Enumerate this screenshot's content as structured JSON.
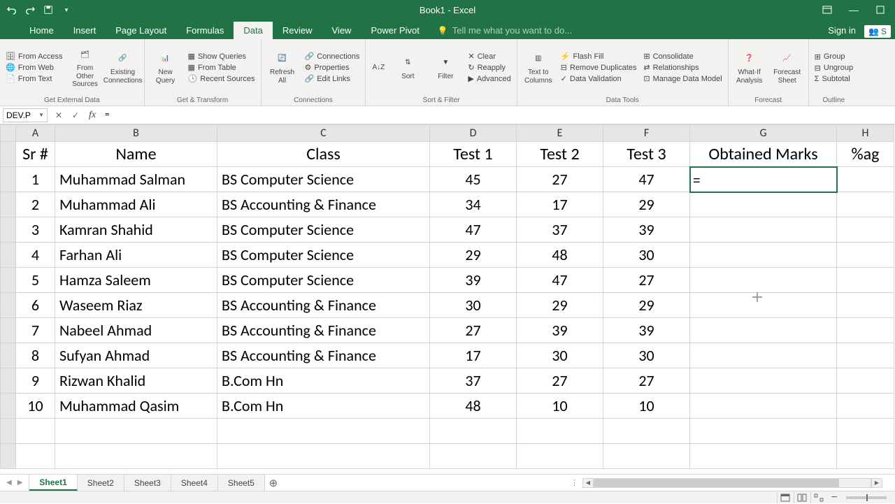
{
  "window": {
    "title": "Book1 - Excel"
  },
  "tabs": {
    "list": [
      "Home",
      "Insert",
      "Page Layout",
      "Formulas",
      "Data",
      "Review",
      "View",
      "Power Pivot"
    ],
    "active": "Data",
    "tellme": "Tell me what you want to do...",
    "signin": "Sign in",
    "share": "S"
  },
  "ribbon": {
    "getExternal": {
      "label": "Get External Data",
      "fromAccess": "From Access",
      "fromWeb": "From Web",
      "fromText": "From Text",
      "fromOther": "From Other Sources",
      "existing": "Existing Connections"
    },
    "getTransform": {
      "label": "Get & Transform",
      "newQuery": "New Query",
      "showQueries": "Show Queries",
      "fromTable": "From Table",
      "recentSources": "Recent Sources"
    },
    "connections": {
      "label": "Connections",
      "refreshAll": "Refresh All",
      "connections": "Connections",
      "properties": "Properties",
      "editLinks": "Edit Links"
    },
    "sortFilter": {
      "label": "Sort & Filter",
      "sort": "Sort",
      "filter": "Filter",
      "clear": "Clear",
      "reapply": "Reapply",
      "advanced": "Advanced"
    },
    "dataTools": {
      "label": "Data Tools",
      "textToColumns": "Text to Columns",
      "flashFill": "Flash Fill",
      "removeDup": "Remove Duplicates",
      "dataValidation": "Data Validation",
      "consolidate": "Consolidate",
      "relationships": "Relationships",
      "manageModel": "Manage Data Model"
    },
    "forecast": {
      "label": "Forecast",
      "whatIf": "What-If Analysis",
      "forecastSheet": "Forecast Sheet"
    },
    "outline": {
      "label": "Outline",
      "group": "Group",
      "ungroup": "Ungroup",
      "subtotal": "Subtotal"
    }
  },
  "formulaBar": {
    "nameBox": "DEV.P",
    "formula": "="
  },
  "columns": [
    "A",
    "B",
    "C",
    "D",
    "E",
    "F",
    "G",
    "H"
  ],
  "headers": {
    "A": "Sr #",
    "B": "Name",
    "C": "Class",
    "D": "Test 1",
    "E": "Test 2",
    "F": "Test 3",
    "G": "Obtained Marks",
    "H": "%ag"
  },
  "rows": [
    {
      "sr": "1",
      "name": "Muhammad Salman",
      "class": "BS Computer Science",
      "t1": "45",
      "t2": "27",
      "t3": "47"
    },
    {
      "sr": "2",
      "name": "Muhammad Ali",
      "class": "BS Accounting & Finance",
      "t1": "34",
      "t2": "17",
      "t3": "29"
    },
    {
      "sr": "3",
      "name": "Kamran Shahid",
      "class": "BS Computer Science",
      "t1": "47",
      "t2": "37",
      "t3": "39"
    },
    {
      "sr": "4",
      "name": "Farhan Ali",
      "class": "BS Computer Science",
      "t1": "29",
      "t2": "48",
      "t3": "30"
    },
    {
      "sr": "5",
      "name": "Hamza Saleem",
      "class": "BS Computer Science",
      "t1": "39",
      "t2": "47",
      "t3": "27"
    },
    {
      "sr": "6",
      "name": "Waseem Riaz",
      "class": "BS Accounting & Finance",
      "t1": "30",
      "t2": "29",
      "t3": "29"
    },
    {
      "sr": "7",
      "name": "Nabeel Ahmad",
      "class": "BS Accounting & Finance",
      "t1": "27",
      "t2": "39",
      "t3": "39"
    },
    {
      "sr": "8",
      "name": "Sufyan Ahmad",
      "class": "BS Accounting & Finance",
      "t1": "17",
      "t2": "30",
      "t3": "30"
    },
    {
      "sr": "9",
      "name": "Rizwan Khalid",
      "class": "B.Com Hn",
      "t1": "37",
      "t2": "27",
      "t3": "27"
    },
    {
      "sr": "10",
      "name": "Muhammad Qasim",
      "class": "B.Com Hn",
      "t1": "48",
      "t2": "10",
      "t3": "10"
    }
  ],
  "editCell": {
    "value": "="
  },
  "sheetTabs": {
    "list": [
      "Sheet1",
      "Sheet2",
      "Sheet3",
      "Sheet4",
      "Sheet5"
    ],
    "active": "Sheet1"
  }
}
